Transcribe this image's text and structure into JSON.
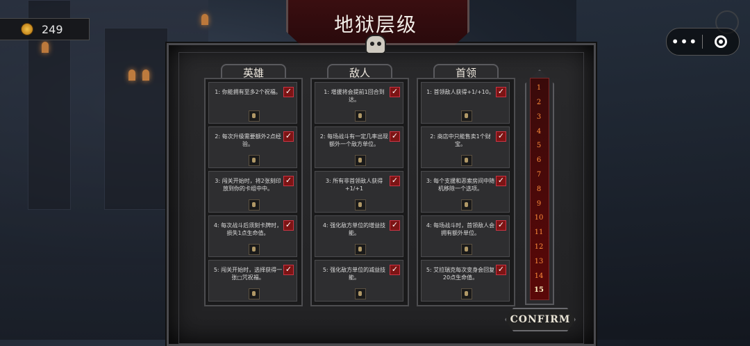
{
  "coins": "249",
  "capsule": {
    "more": "•••"
  },
  "title": "地狱层级",
  "columns": [
    {
      "header": "英雄",
      "cards": [
        "1: 你能拥有至多2个祝福。",
        "2: 每次升级需要额外2点经验。",
        "3: 闯关开始时，将2张刻印放到你的卡组中中。",
        "4: 每次战斗后须刻卡牌时，损失1点生命值。",
        "5: 闯关开始时，选择获得一张□咒祝福。"
      ]
    },
    {
      "header": "敌人",
      "cards": [
        "1: 增援将会提前1回合到达。",
        "2: 每场战斗有一定几率出现额外一个敌方单位。",
        "3: 所有非首领敌人获得+1/+1",
        "4: 强化敌方单位的增益技能。",
        "5: 强化敌方单位的减益技能。"
      ]
    },
    {
      "header": "首领",
      "cards": [
        "1: 首领敌人获得+1/+10。",
        "2: 商店中只能售卖1个财宝。",
        "3: 每个支援和恶索房间中随机移除一个选项。",
        "4: 每场战斗时，首领敌人会拥有额外单位。",
        "5: 艾拉瑞克每次变身会回复20点生命值。"
      ]
    }
  ],
  "levels": [
    "1",
    "2",
    "3",
    "4",
    "5",
    "6",
    "7",
    "8",
    "9",
    "10",
    "11",
    "12",
    "13",
    "14",
    "15"
  ],
  "selected_level": "15",
  "confirm_label": "CONFIRM"
}
